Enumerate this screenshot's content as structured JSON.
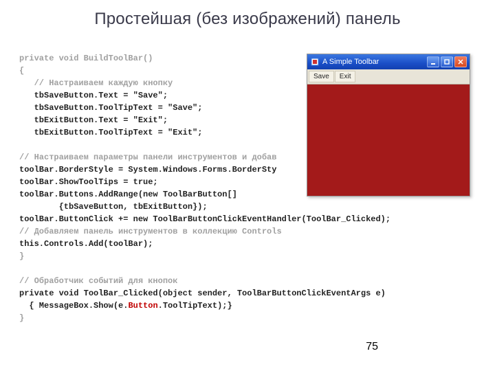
{
  "title": "Простейшая (без изображений) панель",
  "page_number": "75",
  "code": {
    "l01": "private void BuildToolBar()",
    "l02": "{",
    "l03": "   // Настраиваем каждую кнопку",
    "l04": "   tbSaveButton.Text = \"Save\";",
    "l05": "   tbSaveButton.ToolTipText = \"Save\";",
    "l06": "   tbExitButton.Text = \"Exit\";",
    "l07": "   tbExitButton.ToolTipText = \"Exit\";",
    "l08": "",
    "l09": "// Настраиваем параметры панели инструментов и добав",
    "l10": "toolBar.BorderStyle = System.Windows.Forms.BorderSty",
    "l11": "toolBar.ShowToolTips = true;",
    "l12": "toolBar.Buttons.AddRange(new ToolBarButton[]",
    "l13": "        {tbSaveButton, tbExitButton});",
    "l14": "toolBar.ButtonClick += new ToolBarButtonClickEventHandler(ToolBar_Clicked);",
    "l15": "// Добавляем панель инструментов в коллекцию Controls",
    "l16": "this.Controls.Add(toolBar);",
    "l17": "}",
    "l18": "",
    "l19": "// Обработчик событий для кнопок",
    "l20": "private void ToolBar_Clicked(object sender, ToolBarButtonClickEventArgs e)",
    "l21a": "  { MessageBox.Show(e.",
    "l21b": "Button",
    "l21c": ".ToolTipText);}",
    "l22": "}"
  },
  "window": {
    "title": "A Simple Toolbar",
    "buttons": {
      "save": "Save",
      "exit": "Exit"
    }
  }
}
